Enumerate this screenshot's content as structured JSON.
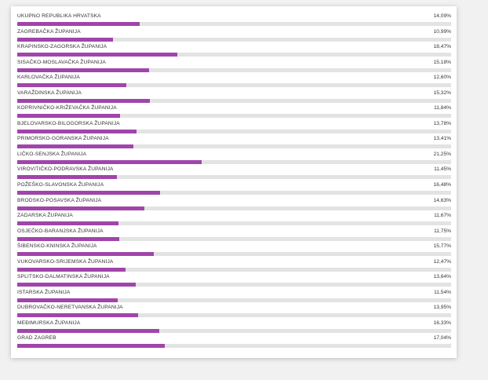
{
  "colors": {
    "bar": "#a045aa",
    "track": "#e3e3e3",
    "text": "#333333"
  },
  "scale_max": 50,
  "rows": [
    {
      "label": "UKUPNO REPUBLIKA HRVATSKA",
      "value_text": "14,09%",
      "value": 14.09
    },
    {
      "label": "ZAGREBAČKA ŽUPANIJA",
      "value_text": "10,99%",
      "value": 10.99
    },
    {
      "label": "KRAPINSKO-ZAGORSKA ŽUPANIJA",
      "value_text": "18,47%",
      "value": 18.47
    },
    {
      "label": "SISAČKO-MOSLAVAČKA ŽUPANIJA",
      "value_text": "15,18%",
      "value": 15.18
    },
    {
      "label": "KARLOVAČKA ŽUPANIJA",
      "value_text": "12,60%",
      "value": 12.6
    },
    {
      "label": "VARAŽDINSKA ŽUPANIJA",
      "value_text": "15,32%",
      "value": 15.32
    },
    {
      "label": "KOPRIVNIČKO-KRIŽEVAČKA ŽUPANIJA",
      "value_text": "11,84%",
      "value": 11.84
    },
    {
      "label": "BJELOVARSKO-BILOGORSKA ŽUPANIJA",
      "value_text": "13,78%",
      "value": 13.78
    },
    {
      "label": "PRIMORSKO-GORANSKA ŽUPANIJA",
      "value_text": "13,41%",
      "value": 13.41
    },
    {
      "label": "LIČKO-SENJSKA ŽUPANIJA",
      "value_text": "21,25%",
      "value": 21.25
    },
    {
      "label": "VIROVITIČKO-PODRAVSKA ŽUPANIJA",
      "value_text": "11,45%",
      "value": 11.45
    },
    {
      "label": "POŽEŠKO-SLAVONSKA ŽUPANIJA",
      "value_text": "16,48%",
      "value": 16.48
    },
    {
      "label": "BRODSKO-POSAVSKA ŽUPANIJA",
      "value_text": "14,63%",
      "value": 14.63
    },
    {
      "label": "ZADARSKA ŽUPANIJA",
      "value_text": "11,67%",
      "value": 11.67
    },
    {
      "label": "OSJEČKO-BARANJSKA ŽUPANIJA",
      "value_text": "11,75%",
      "value": 11.75
    },
    {
      "label": "ŠIBENSKO-KNINSKA ŽUPANIJA",
      "value_text": "15,77%",
      "value": 15.77
    },
    {
      "label": "VUKOVARSKO-SRIJEMSKA ŽUPANIJA",
      "value_text": "12,47%",
      "value": 12.47
    },
    {
      "label": "SPLITSKO-DALMATINSKA ŽUPANIJA",
      "value_text": "13,64%",
      "value": 13.64
    },
    {
      "label": "ISTARSKA ŽUPANIJA",
      "value_text": "11,54%",
      "value": 11.54
    },
    {
      "label": "DUBROVAČKO-NERETVANSKA ŽUPANIJA",
      "value_text": "13,95%",
      "value": 13.95
    },
    {
      "label": "MEĐIMURSKA ŽUPANIJA",
      "value_text": "16,33%",
      "value": 16.33
    },
    {
      "label": "GRAD ZAGREB",
      "value_text": "17,04%",
      "value": 17.04
    }
  ]
}
